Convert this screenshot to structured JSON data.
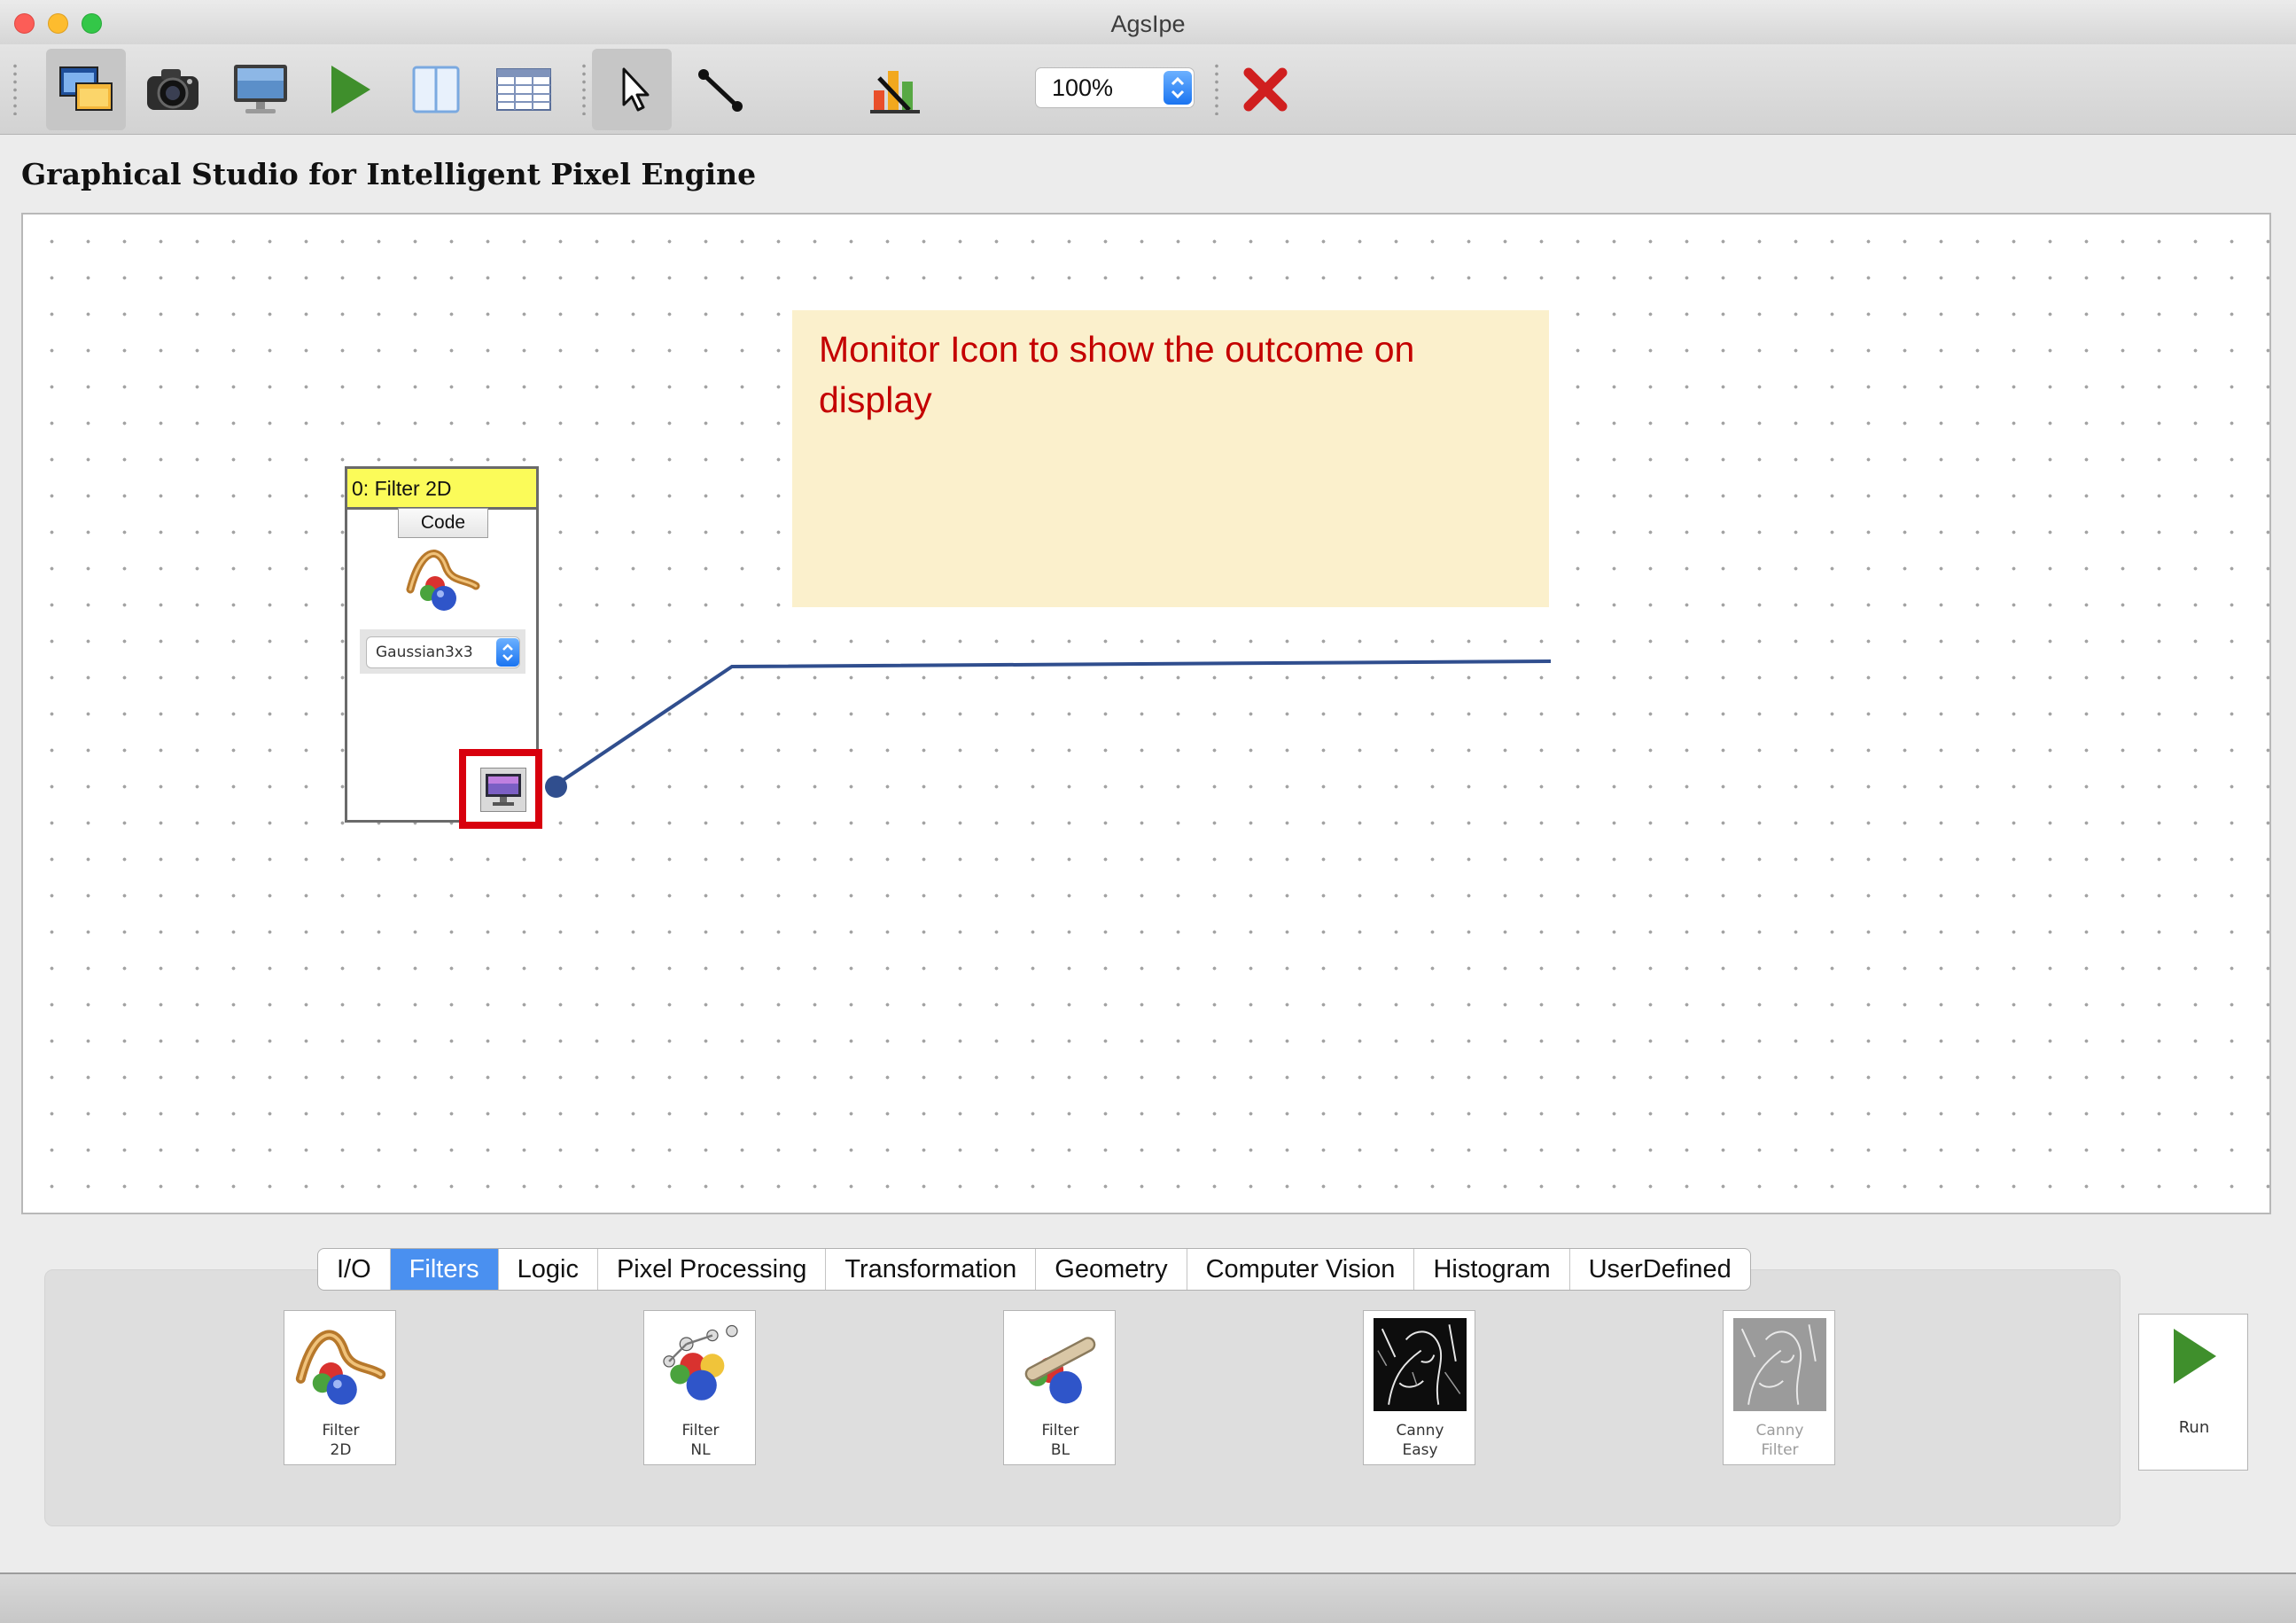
{
  "window": {
    "title": "AgsIpe"
  },
  "toolbar": {
    "buttons": [
      {
        "name": "open-windows",
        "icon": "windows-icon"
      },
      {
        "name": "camera",
        "icon": "camera-icon"
      },
      {
        "name": "monitor",
        "icon": "monitor-icon"
      },
      {
        "name": "run",
        "icon": "play-icon"
      },
      {
        "name": "split-view",
        "icon": "columns-icon"
      },
      {
        "name": "table-view",
        "icon": "table-icon"
      },
      {
        "name": "select-tool",
        "icon": "cursor-icon",
        "active": true
      },
      {
        "name": "connect-tool",
        "icon": "link-icon"
      },
      {
        "name": "chart",
        "icon": "chart-icon"
      },
      {
        "name": "delete",
        "icon": "close-icon"
      }
    ],
    "zoom": "100%"
  },
  "page": {
    "title": "Graphical Studio for Intelligent Pixel Engine"
  },
  "canvas": {
    "annotation": "Monitor Icon to show the outcome on display",
    "node": {
      "title": "0: Filter 2D",
      "code_label": "Code",
      "selected_filter": "Gaussian3x3",
      "monitor_port_highlighted": true
    }
  },
  "palette": {
    "tabs": [
      "I/O",
      "Filters",
      "Logic",
      "Pixel Processing",
      "Transformation",
      "Geometry",
      "Computer Vision",
      "Histogram",
      "UserDefined"
    ],
    "selected_tab": "Filters",
    "tools": [
      {
        "line1": "Filter",
        "line2": "2D",
        "icon": "filter-2d-icon",
        "enabled": true
      },
      {
        "line1": "Filter",
        "line2": "NL",
        "icon": "filter-nl-icon",
        "enabled": true
      },
      {
        "line1": "Filter",
        "line2": "BL",
        "icon": "filter-bl-icon",
        "enabled": true
      },
      {
        "line1": "Canny",
        "line2": "Easy",
        "icon": "canny-easy-icon",
        "enabled": true
      },
      {
        "line1": "Canny",
        "line2": "Filter",
        "icon": "canny-filter-icon",
        "enabled": false
      }
    ],
    "run_label": "Run"
  },
  "colors": {
    "selected_tab": "#4a90f0",
    "annotation_text": "#c40000",
    "annotation_bg": "#fbf0cc",
    "node_header": "#fbfb59",
    "highlight": "#d8000d",
    "link": "#304e8e"
  }
}
